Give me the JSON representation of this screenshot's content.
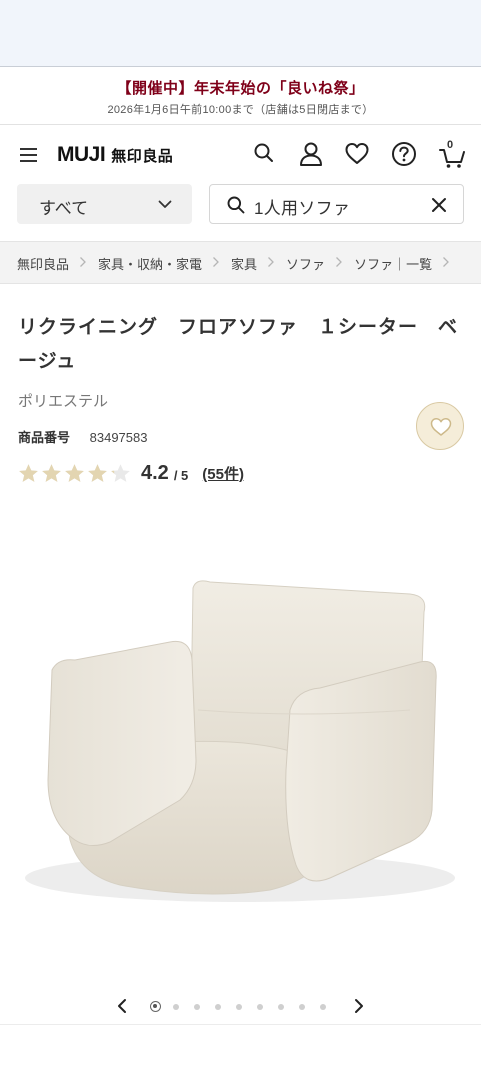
{
  "promo": {
    "title": "【開催中】年末年始の「良いね祭」",
    "subtitle": "2026年1月6日午前10:00まで（店舗は5日閉店まで）",
    "accent_color": "#7f0019"
  },
  "header": {
    "logo_en": "MUJI",
    "logo_ja": "無印良品",
    "cart_count": "0",
    "icons": [
      "menu-icon",
      "search-icon",
      "account-icon",
      "heart-icon",
      "help-icon",
      "cart-icon"
    ]
  },
  "search": {
    "category": "すべて",
    "query": "1人用ソファ"
  },
  "breadcrumb": [
    "無印良品",
    "家具・収納・家電",
    "家具",
    "ソファ",
    "ソファ｜一覧"
  ],
  "product": {
    "title": "リクライニング　フロアソファ　１シーター　ベージュ",
    "material": "ポリエステル",
    "code_label": "商品番号",
    "code_value": "83497583",
    "rating_value": "4.2",
    "rating_max": "/ 5",
    "rating_fraction": 0.84,
    "review_count": "(55件)",
    "star_color": "#e3d5b1",
    "image_icon": "sofa-image"
  },
  "carousel": {
    "total": 9,
    "active_index": 0
  }
}
